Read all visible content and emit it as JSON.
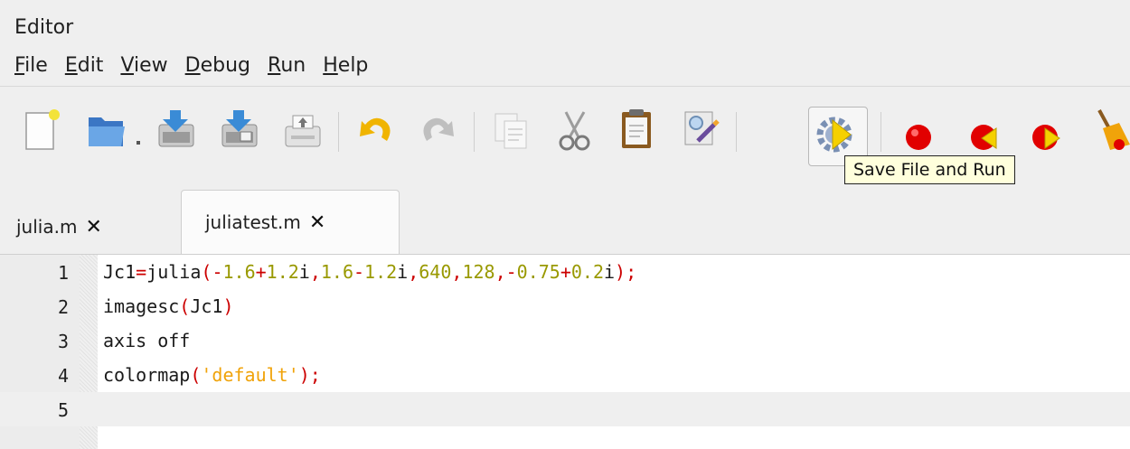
{
  "window": {
    "title": "Editor"
  },
  "menu": [
    {
      "first": "F",
      "rest": "ile"
    },
    {
      "first": "E",
      "rest": "dit"
    },
    {
      "first": "V",
      "rest": "iew"
    },
    {
      "first": "D",
      "rest": "ebug"
    },
    {
      "first": "R",
      "rest": "un"
    },
    {
      "first": "H",
      "rest": "elp"
    }
  ],
  "toolbar": {
    "buttons": [
      "new-file",
      "open-file",
      "dropdown-dot",
      "save-file",
      "save-file-as",
      "print",
      "undo",
      "redo",
      "copy",
      "cut",
      "paste",
      "find-replace",
      "save-file-and-run",
      "breakpoint",
      "previous-breakpoint",
      "next-breakpoint",
      "clear-breakpoints"
    ],
    "tooltip": "Save File and Run"
  },
  "tabs": [
    {
      "label": "julia.m",
      "active": false
    },
    {
      "label": "juliatest.m",
      "active": true
    }
  ],
  "editor": {
    "lines": [
      {
        "number": "1",
        "tokens": [
          {
            "t": "Jc1",
            "k": "id"
          },
          {
            "t": "=",
            "k": "op"
          },
          {
            "t": "julia",
            "k": "id"
          },
          {
            "t": "(",
            "k": "op"
          },
          {
            "t": "-",
            "k": "op"
          },
          {
            "t": "1.6",
            "k": "num"
          },
          {
            "t": "+",
            "k": "op"
          },
          {
            "t": "1.2",
            "k": "num"
          },
          {
            "t": "i",
            "k": "id"
          },
          {
            "t": ",",
            "k": "op"
          },
          {
            "t": "1.6",
            "k": "num"
          },
          {
            "t": "-",
            "k": "op"
          },
          {
            "t": "1.2",
            "k": "num"
          },
          {
            "t": "i",
            "k": "id"
          },
          {
            "t": ",",
            "k": "op"
          },
          {
            "t": "640",
            "k": "num"
          },
          {
            "t": ",",
            "k": "op"
          },
          {
            "t": "128",
            "k": "num"
          },
          {
            "t": ",",
            "k": "op"
          },
          {
            "t": "-",
            "k": "op"
          },
          {
            "t": "0.75",
            "k": "num"
          },
          {
            "t": "+",
            "k": "op"
          },
          {
            "t": "0.2",
            "k": "num"
          },
          {
            "t": "i",
            "k": "id"
          },
          {
            "t": ");",
            "k": "op"
          }
        ]
      },
      {
        "number": "2",
        "tokens": [
          {
            "t": "imagesc",
            "k": "id"
          },
          {
            "t": "(",
            "k": "op"
          },
          {
            "t": "Jc1",
            "k": "id"
          },
          {
            "t": ")",
            "k": "op"
          }
        ]
      },
      {
        "number": "3",
        "tokens": [
          {
            "t": "axis off",
            "k": "id"
          }
        ]
      },
      {
        "number": "4",
        "tokens": [
          {
            "t": "colormap",
            "k": "id"
          },
          {
            "t": "(",
            "k": "op"
          },
          {
            "t": "'default'",
            "k": "str"
          },
          {
            "t": ");",
            "k": "op"
          }
        ]
      },
      {
        "number": "5",
        "tokens": []
      }
    ],
    "current_line": "5"
  },
  "colors": {
    "operator": "#cc0000",
    "number": "#999900",
    "string": "#f0a30a",
    "breakpoint_red": "#e10000",
    "arrow_yellow": "#f5d000"
  }
}
